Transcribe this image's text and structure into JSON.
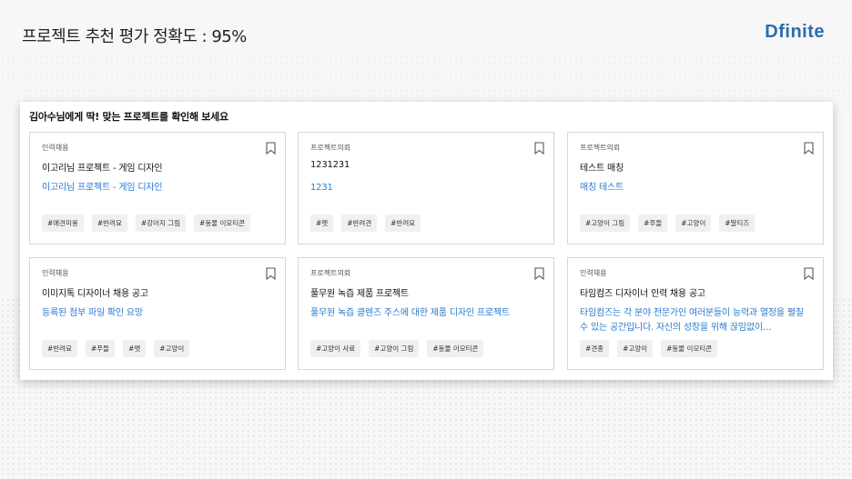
{
  "slide": {
    "title": "프로젝트 추천 평가 정확도 : 95%",
    "logo": "Dfinite"
  },
  "panel": {
    "heading": "김아수님에게 딱! 맞는 프로젝트를 확인해 보세요"
  },
  "cards": [
    {
      "category": "인력채용",
      "title": "이고리님 프로젝트 - 게임 디자인",
      "description": "이고리님 프로젝트 - 게임 디자인",
      "tags": [
        "#애견미용",
        "#반려묘",
        "#강아지 그림",
        "#동물 이모티콘"
      ]
    },
    {
      "category": "프로젝트의뢰",
      "title": "1231231",
      "description": "1231",
      "tags": [
        "#펫",
        "#반려견",
        "#반려묘"
      ]
    },
    {
      "category": "프로젝트의뢰",
      "title": "테스트 매칭",
      "description": "매칭 테스트",
      "tags": [
        "#고양이 그림",
        "#푸들",
        "#고양이",
        "#말티즈"
      ]
    },
    {
      "category": "인력채용",
      "title": "이미지톡 디자이너 채용 공고",
      "description": "등록된 첨부 파일 확인 요망",
      "tags": [
        "#반려묘",
        "#푸들",
        "#펫",
        "#고양이"
      ]
    },
    {
      "category": "프로젝트의뢰",
      "title": "풀무원 녹즙 제품 프로젝트",
      "description": "풀무원 녹즙 클렌즈 주스에 대한 제품 디자인 프로젝트",
      "tags": [
        "#고양이 사료",
        "#고양이 그림",
        "#동물 이모티콘"
      ]
    },
    {
      "category": "인력채용",
      "title": "타임컴즈 디자이너 인력 채용 공고",
      "description": "타임컴즈는 각 분야 전문가인 여러분들이 능력과 열정을 펼칠 수 있는 공간입니다. 자신의 성장을 위해 끊임없이…",
      "tags": [
        "#견종",
        "#고양이",
        "#동물 이모티콘"
      ]
    }
  ]
}
